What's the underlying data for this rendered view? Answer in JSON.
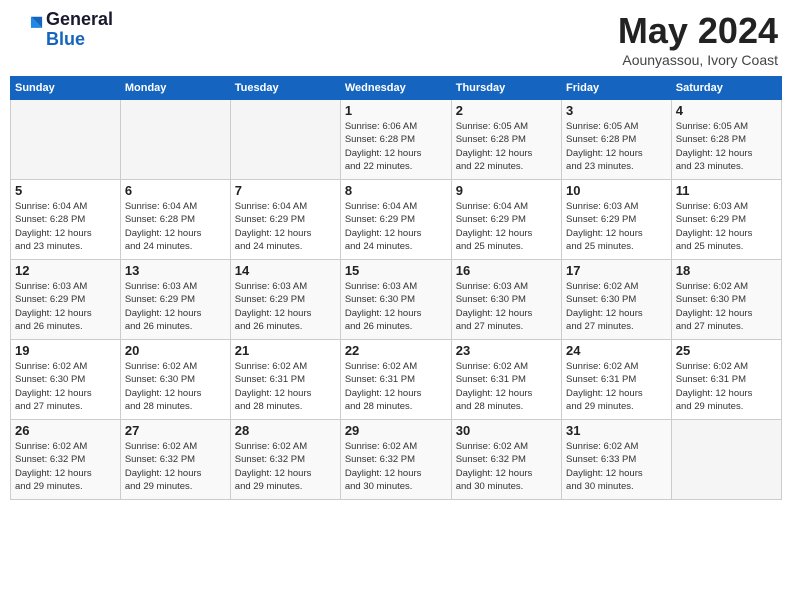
{
  "header": {
    "logo_line1": "General",
    "logo_line2": "Blue",
    "month_title": "May 2024",
    "location": "Aounyassou, Ivory Coast"
  },
  "days_of_week": [
    "Sunday",
    "Monday",
    "Tuesday",
    "Wednesday",
    "Thursday",
    "Friday",
    "Saturday"
  ],
  "weeks": [
    [
      {
        "day": "",
        "info": ""
      },
      {
        "day": "",
        "info": ""
      },
      {
        "day": "",
        "info": ""
      },
      {
        "day": "1",
        "info": "Sunrise: 6:06 AM\nSunset: 6:28 PM\nDaylight: 12 hours\nand 22 minutes."
      },
      {
        "day": "2",
        "info": "Sunrise: 6:05 AM\nSunset: 6:28 PM\nDaylight: 12 hours\nand 22 minutes."
      },
      {
        "day": "3",
        "info": "Sunrise: 6:05 AM\nSunset: 6:28 PM\nDaylight: 12 hours\nand 23 minutes."
      },
      {
        "day": "4",
        "info": "Sunrise: 6:05 AM\nSunset: 6:28 PM\nDaylight: 12 hours\nand 23 minutes."
      }
    ],
    [
      {
        "day": "5",
        "info": "Sunrise: 6:04 AM\nSunset: 6:28 PM\nDaylight: 12 hours\nand 23 minutes."
      },
      {
        "day": "6",
        "info": "Sunrise: 6:04 AM\nSunset: 6:28 PM\nDaylight: 12 hours\nand 24 minutes."
      },
      {
        "day": "7",
        "info": "Sunrise: 6:04 AM\nSunset: 6:29 PM\nDaylight: 12 hours\nand 24 minutes."
      },
      {
        "day": "8",
        "info": "Sunrise: 6:04 AM\nSunset: 6:29 PM\nDaylight: 12 hours\nand 24 minutes."
      },
      {
        "day": "9",
        "info": "Sunrise: 6:04 AM\nSunset: 6:29 PM\nDaylight: 12 hours\nand 25 minutes."
      },
      {
        "day": "10",
        "info": "Sunrise: 6:03 AM\nSunset: 6:29 PM\nDaylight: 12 hours\nand 25 minutes."
      },
      {
        "day": "11",
        "info": "Sunrise: 6:03 AM\nSunset: 6:29 PM\nDaylight: 12 hours\nand 25 minutes."
      }
    ],
    [
      {
        "day": "12",
        "info": "Sunrise: 6:03 AM\nSunset: 6:29 PM\nDaylight: 12 hours\nand 26 minutes."
      },
      {
        "day": "13",
        "info": "Sunrise: 6:03 AM\nSunset: 6:29 PM\nDaylight: 12 hours\nand 26 minutes."
      },
      {
        "day": "14",
        "info": "Sunrise: 6:03 AM\nSunset: 6:29 PM\nDaylight: 12 hours\nand 26 minutes."
      },
      {
        "day": "15",
        "info": "Sunrise: 6:03 AM\nSunset: 6:30 PM\nDaylight: 12 hours\nand 26 minutes."
      },
      {
        "day": "16",
        "info": "Sunrise: 6:03 AM\nSunset: 6:30 PM\nDaylight: 12 hours\nand 27 minutes."
      },
      {
        "day": "17",
        "info": "Sunrise: 6:02 AM\nSunset: 6:30 PM\nDaylight: 12 hours\nand 27 minutes."
      },
      {
        "day": "18",
        "info": "Sunrise: 6:02 AM\nSunset: 6:30 PM\nDaylight: 12 hours\nand 27 minutes."
      }
    ],
    [
      {
        "day": "19",
        "info": "Sunrise: 6:02 AM\nSunset: 6:30 PM\nDaylight: 12 hours\nand 27 minutes."
      },
      {
        "day": "20",
        "info": "Sunrise: 6:02 AM\nSunset: 6:30 PM\nDaylight: 12 hours\nand 28 minutes."
      },
      {
        "day": "21",
        "info": "Sunrise: 6:02 AM\nSunset: 6:31 PM\nDaylight: 12 hours\nand 28 minutes."
      },
      {
        "day": "22",
        "info": "Sunrise: 6:02 AM\nSunset: 6:31 PM\nDaylight: 12 hours\nand 28 minutes."
      },
      {
        "day": "23",
        "info": "Sunrise: 6:02 AM\nSunset: 6:31 PM\nDaylight: 12 hours\nand 28 minutes."
      },
      {
        "day": "24",
        "info": "Sunrise: 6:02 AM\nSunset: 6:31 PM\nDaylight: 12 hours\nand 29 minutes."
      },
      {
        "day": "25",
        "info": "Sunrise: 6:02 AM\nSunset: 6:31 PM\nDaylight: 12 hours\nand 29 minutes."
      }
    ],
    [
      {
        "day": "26",
        "info": "Sunrise: 6:02 AM\nSunset: 6:32 PM\nDaylight: 12 hours\nand 29 minutes."
      },
      {
        "day": "27",
        "info": "Sunrise: 6:02 AM\nSunset: 6:32 PM\nDaylight: 12 hours\nand 29 minutes."
      },
      {
        "day": "28",
        "info": "Sunrise: 6:02 AM\nSunset: 6:32 PM\nDaylight: 12 hours\nand 29 minutes."
      },
      {
        "day": "29",
        "info": "Sunrise: 6:02 AM\nSunset: 6:32 PM\nDaylight: 12 hours\nand 30 minutes."
      },
      {
        "day": "30",
        "info": "Sunrise: 6:02 AM\nSunset: 6:32 PM\nDaylight: 12 hours\nand 30 minutes."
      },
      {
        "day": "31",
        "info": "Sunrise: 6:02 AM\nSunset: 6:33 PM\nDaylight: 12 hours\nand 30 minutes."
      },
      {
        "day": "",
        "info": ""
      }
    ]
  ]
}
